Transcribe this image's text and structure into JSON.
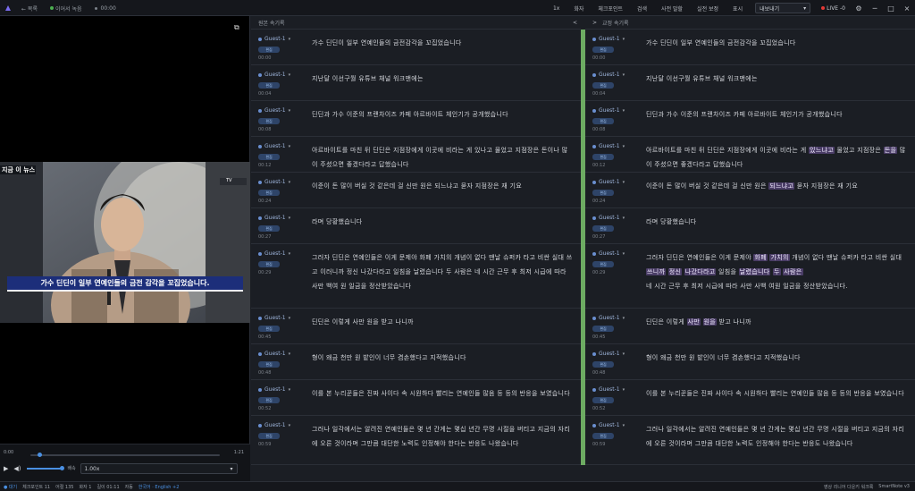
{
  "topbar": {
    "back_label": "← 목록",
    "status_label": "이어서 녹음",
    "time_label": "00:00",
    "menus": [
      "1x",
      "화자",
      "체크포인트",
      "검색",
      "사전 말할",
      "실전 보정",
      "표시"
    ],
    "export_label": "내보내기",
    "live_label": "LIVE -0",
    "window_buttons": [
      "─",
      "□",
      "×"
    ]
  },
  "video": {
    "caption": "가수 딘딘이 일부 연예인들의 금전 감각을 꼬집었습니다.",
    "channel_tag": "지금 이 뉴스",
    "news_tag": "TV"
  },
  "player": {
    "time_start": "0:00",
    "time_end": "1:21",
    "progress": 0.04,
    "speed_label": "배속",
    "speed_value": "1.00x"
  },
  "panels": {
    "left_title": "원본 속기록",
    "right_title": "교정 속기록",
    "collapse_icon": "<",
    "expand_icon": ">"
  },
  "speaker_badge": "편집",
  "rows": [
    {
      "speaker": "Guest-1",
      "time": "00:00",
      "text": "가수 딘딘이 일부 연예인들의 금전감각을 꼬집었습니다"
    },
    {
      "speaker": "Guest-1",
      "time": "00:04",
      "text": "지난달 이선구월 유튜브 채널 워크맨에는"
    },
    {
      "speaker": "Guest-1",
      "time": "00:08",
      "text": "딘딘과 가수 이준의 프랜차이즈 카페 아르바이트 체인기가 공개했습니다"
    },
    {
      "speaker": "Guest-1",
      "time": "00:12",
      "text": "아르바이트를 마친 뒤 딘딘은 지점장에게 이곳에 비라는 게 있나고 물었고 지점장은 돈이나 많이 주셨으면 좋겠다라고 답했습니다"
    },
    {
      "speaker": "Guest-1",
      "time": "00:24",
      "text": "이준이 돈 많이 버실 것 같은데 걸 신만 원은 되느냐고 묻자 지점장은 재 기요"
    },
    {
      "speaker": "Guest-1",
      "time": "00:27",
      "text": "라며 당황했습니다"
    },
    {
      "speaker": "Guest-1",
      "time": "00:29",
      "text": "그러자 딘딘은 연예인들은 이게 문제야 화폐 가치의 개념이 없다 땐날 슈퍼카 타고 비싼 실대 쓰고 이러니까 정신 나갔다라고 일침을 날렸습니다 두 사람은 네 시간 근무 후 최저 시급에 따라 사만 백여 원 일금을 정산받았습니다"
    },
    {
      "speaker": "Guest-1",
      "time": "00:45",
      "text": "딘딘은 이렇게 사만 원을 받고 나니까"
    },
    {
      "speaker": "Guest-1",
      "time": "00:48",
      "text": "형이 왜금 천만 원 밭인이 너무 겸손했다고 지적했습니다"
    },
    {
      "speaker": "Guest-1",
      "time": "00:52",
      "text": "이를 본 누리꾼들은 진짜 사이다 속 시원하다 빨리는 연예인들 많음 등 등의 반응을 보였습니다"
    },
    {
      "speaker": "Guest-1",
      "time": "00:59",
      "text": "그러나 일각에서는 알려진 연예인들은 몇 년 간게는 몇십 년간 무명 시절을 버티고 지금의 자리에 오른 것이라며 그만큼 대단한 노력도 인정해야 한다는 반응도 나왔습니다"
    }
  ],
  "right_rows": [
    {
      "pre": "가수 딘딘이 일부 연예인들의 금전감각을 꼬집었습니다"
    },
    {
      "pre": "지난달 이선구월 유튜브 채널 워크맨에는"
    },
    {
      "pre": "딘딘과 가수 이준의 프랜차이즈 카페 아르바이트 체인기가 공개했습니다"
    },
    {
      "pre": "아르바이트를 마친 뒤 딘딘은 지점장에게 이곳에 비라는 게 ",
      "hl1": "있느냐고",
      "mid": " 물었고 지점장은 ",
      "hl2": "돈을",
      "post": " 많이 주셨으면 좋겠다라고 답했습니다"
    },
    {
      "pre": "이준이 돈 많이 버실 것 같은데 걸 신만 원은 ",
      "hl1": "되느냐고",
      "post": " 묻자 지점장은 재 기요"
    },
    {
      "pre": "라며 당황했습니다"
    },
    {
      "pre": "그러자 딘딘은 연예인들은 이게 문제야 ",
      "hl1": "화폐",
      "mid": " ",
      "hl2": "가치의",
      "post": " 개념이 없다 땐날 슈퍼카 타고 비싼 실대 ",
      "hl3": "쓰니까",
      "post2": " ",
      "hl4": "정신",
      "post3": " ",
      "hl5": "나갔다라고",
      "post4": " 일침을 ",
      "hl6": "날렸습니다",
      "post5": " ",
      "hl7": "두",
      "post6": " ",
      "hl8": "사람은",
      "tail": "네 시간 근무 후 최저 시급에 따라 사만 사백 여원 일금을 정산받았습니다."
    },
    {
      "pre": "딘딘은 이렇게 ",
      "hl1": "사만",
      "mid": " ",
      "hl2": "원을",
      "post": " 받고 나니까"
    },
    {
      "pre": "형이 왜금 천만 원 밭인이 너무 겸손했다고 지적했습니다"
    },
    {
      "pre": "이를 본 누리꾼들은 진짜 사이다 속 시원하다 빨리는 연예인들 많음 등 등의 반응을 보였습니다"
    },
    {
      "pre": "그러나 일각에서는 알려진 연예인들은 몇 년 간게는 몇십 년간 무명 시절을 버티고 지금의 자리에 오른 것이라며 그만큼 대단한 노력도 인정해야 한다는 반응도 나왔습니다"
    }
  ],
  "statusbar": {
    "state": "● 대기",
    "checkpoint": "체크포인트 11",
    "words": "어절 135",
    "speakers": "화자 1",
    "duration": "길이 01:11",
    "lang_label": "자동",
    "lang_value": "한국어 · English +2",
    "right_text": "영상 리니어 다운키 워크룩",
    "version": "SmartNote v3"
  }
}
